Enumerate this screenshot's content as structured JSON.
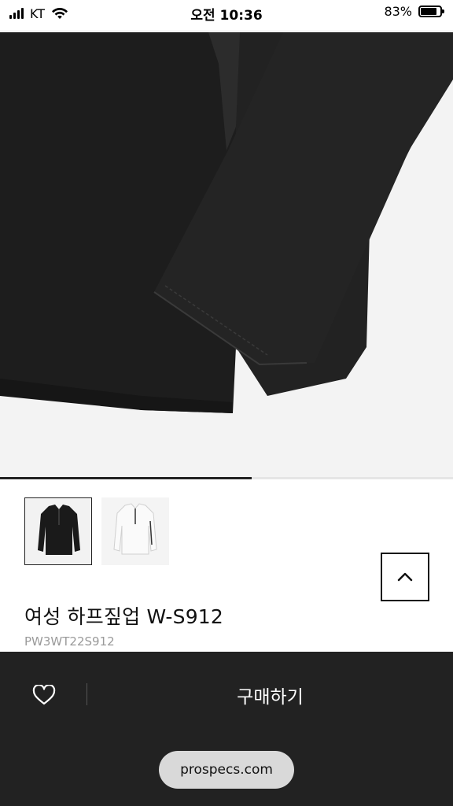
{
  "status_bar": {
    "carrier": "KT",
    "time": "오전 10:36",
    "battery_percent": "83%",
    "battery_level": 0.83,
    "signal_bars": 4
  },
  "gallery": {
    "progress": 0.555,
    "thumbnails": [
      {
        "name": "black-shirt",
        "color": "#1a1a1a",
        "selected": true
      },
      {
        "name": "white-shirt",
        "color": "#f2f2f2",
        "selected": false
      }
    ]
  },
  "product": {
    "name": "여성 하프짚업 W-S912",
    "code": "PW3WT22S912"
  },
  "icons": {
    "top": "chevron-up-icon",
    "wish": "heart-icon"
  },
  "actions": {
    "buy_label": "구매하기"
  },
  "browser": {
    "url": "prospecs.com"
  },
  "colors": {
    "bottom_bar": "#222222",
    "accent": "#111111"
  }
}
